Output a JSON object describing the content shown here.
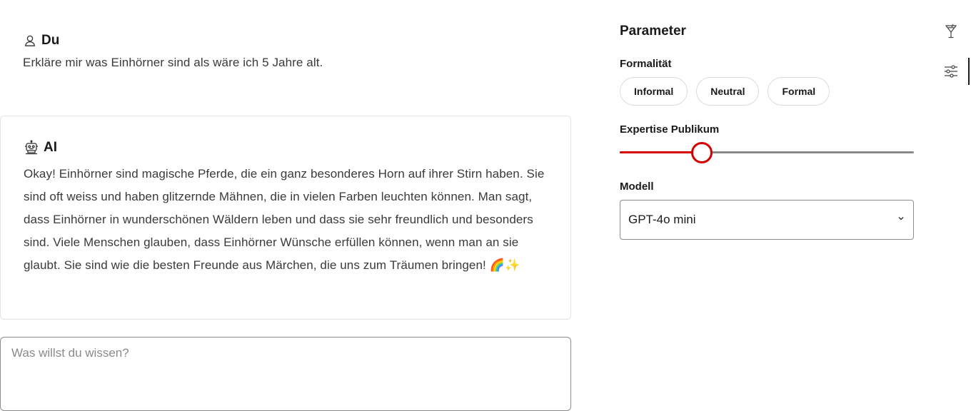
{
  "chat": {
    "user": {
      "name": "Du",
      "text": "Erkläre mir was Einhörner sind als wäre ich 5 Jahre alt."
    },
    "ai": {
      "name": "AI",
      "text": "Okay! Einhörner sind magische Pferde, die ein ganz besonderes Horn auf ihrer Stirn haben. Sie sind oft weiss und haben glitzernde Mähnen, die in vielen Farben leuchten können. Man sagt, dass Einhörner in wunderschönen Wäldern leben und dass sie sehr freundlich und besonders sind. Viele Menschen glauben, dass Einhörner Wünsche erfüllen können, wenn man an sie glaubt. Sie sind wie die besten Freunde aus Märchen, die uns zum Träumen bringen! 🌈✨"
    },
    "composer": {
      "placeholder": "Was willst du wissen?"
    }
  },
  "params": {
    "title": "Parameter",
    "formality": {
      "label": "Formalität",
      "options": [
        "Informal",
        "Neutral",
        "Formal"
      ]
    },
    "expertise": {
      "label": "Expertise Publikum",
      "value_fraction": 0.28
    },
    "model": {
      "label": "Modell",
      "selected": "GPT-4o mini"
    }
  },
  "rail": {
    "icons": [
      "cocktail-glass-icon",
      "sliders-icon"
    ],
    "active": "sliders-icon"
  },
  "colors": {
    "accent": "#d40000",
    "border": "#e3e3e3",
    "track": "#8a8a8a"
  }
}
